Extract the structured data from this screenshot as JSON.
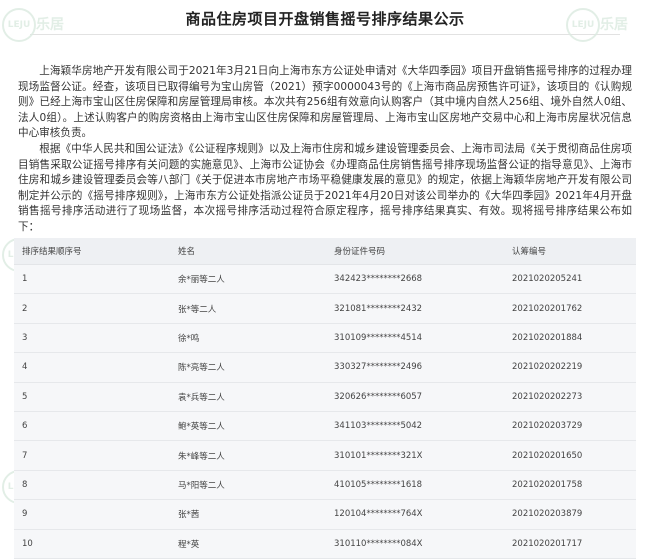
{
  "title": "商品住房项目开盘销售摇号排序结果公示",
  "paragraphs": [
    "上海颖华房地产开发有限公司于2021年3月21日向上海市东方公证处申请对《大华四季园》项目开盘销售摇号排序的过程办理现场监督公证。经查，该项目已取得编号为宝山房管（2021）预字0000043号的《上海市商品房预售许可证》，该项目的《认购规则》已经上海市宝山区住房保障和房屋管理局审核。本次共有256组有效意向认购客户（其中境内自然人256组、境外自然人0组、法人0组）。上述认购客户的购房资格由上海市宝山区住房保障和房屋管理局、上海市宝山区房地产交易中心和上海市房屋状况信息中心审核负责。",
    "根据《中华人民共和国公证法》《公证程序规则》以及上海市住房和城乡建设管理委员会、上海市司法局《关于贯彻商品住房项目销售采取公证摇号排序有关问题的实施意见》、上海市公证协会《办理商品住房销售摇号排序现场监督公证的指导意见》、上海市住房和城乡建设管理委员会等八部门《关于促进本市房地产市场平稳健康发展的意见》的规定，依据上海颖华房地产开发有限公司制定并公示的《摇号排序规则》，上海市东方公证处指派公证员于2021年4月20日对该公司举办的《大华四季园》2021年4月开盘销售摇号排序活动进行了现场监督，本次摇号排序活动过程符合原定程序，摇号排序结果真实、有效。现将摇号排序结果公布如下："
  ],
  "table": {
    "headers": [
      "排序结果顺序号",
      "姓名",
      "身份证件号码",
      "认筹编号"
    ],
    "rows": [
      [
        "1",
        "余*丽等二人",
        "342423********2668",
        "2021020205241"
      ],
      [
        "2",
        "张*等二人",
        "321081********2432",
        "2021020201762"
      ],
      [
        "3",
        "徐*鸣",
        "310109********4514",
        "2021020201884"
      ],
      [
        "4",
        "陈*亮等二人",
        "330327********2496",
        "2021020202219"
      ],
      [
        "5",
        "袁*兵等二人",
        "320626********6057",
        "2021020202273"
      ],
      [
        "6",
        "鲍*英等二人",
        "341103********5042",
        "2021020203729"
      ],
      [
        "7",
        "朱*峰等二人",
        "310101********321X",
        "2021020201650"
      ],
      [
        "8",
        "马*阳等二人",
        "410105********1618",
        "2021020201758"
      ],
      [
        "9",
        "张*茜",
        "120104********764X",
        "2021020203879"
      ],
      [
        "10",
        "程*英",
        "310110********084X",
        "2021020201717"
      ]
    ]
  },
  "watermark_label": "乐居"
}
